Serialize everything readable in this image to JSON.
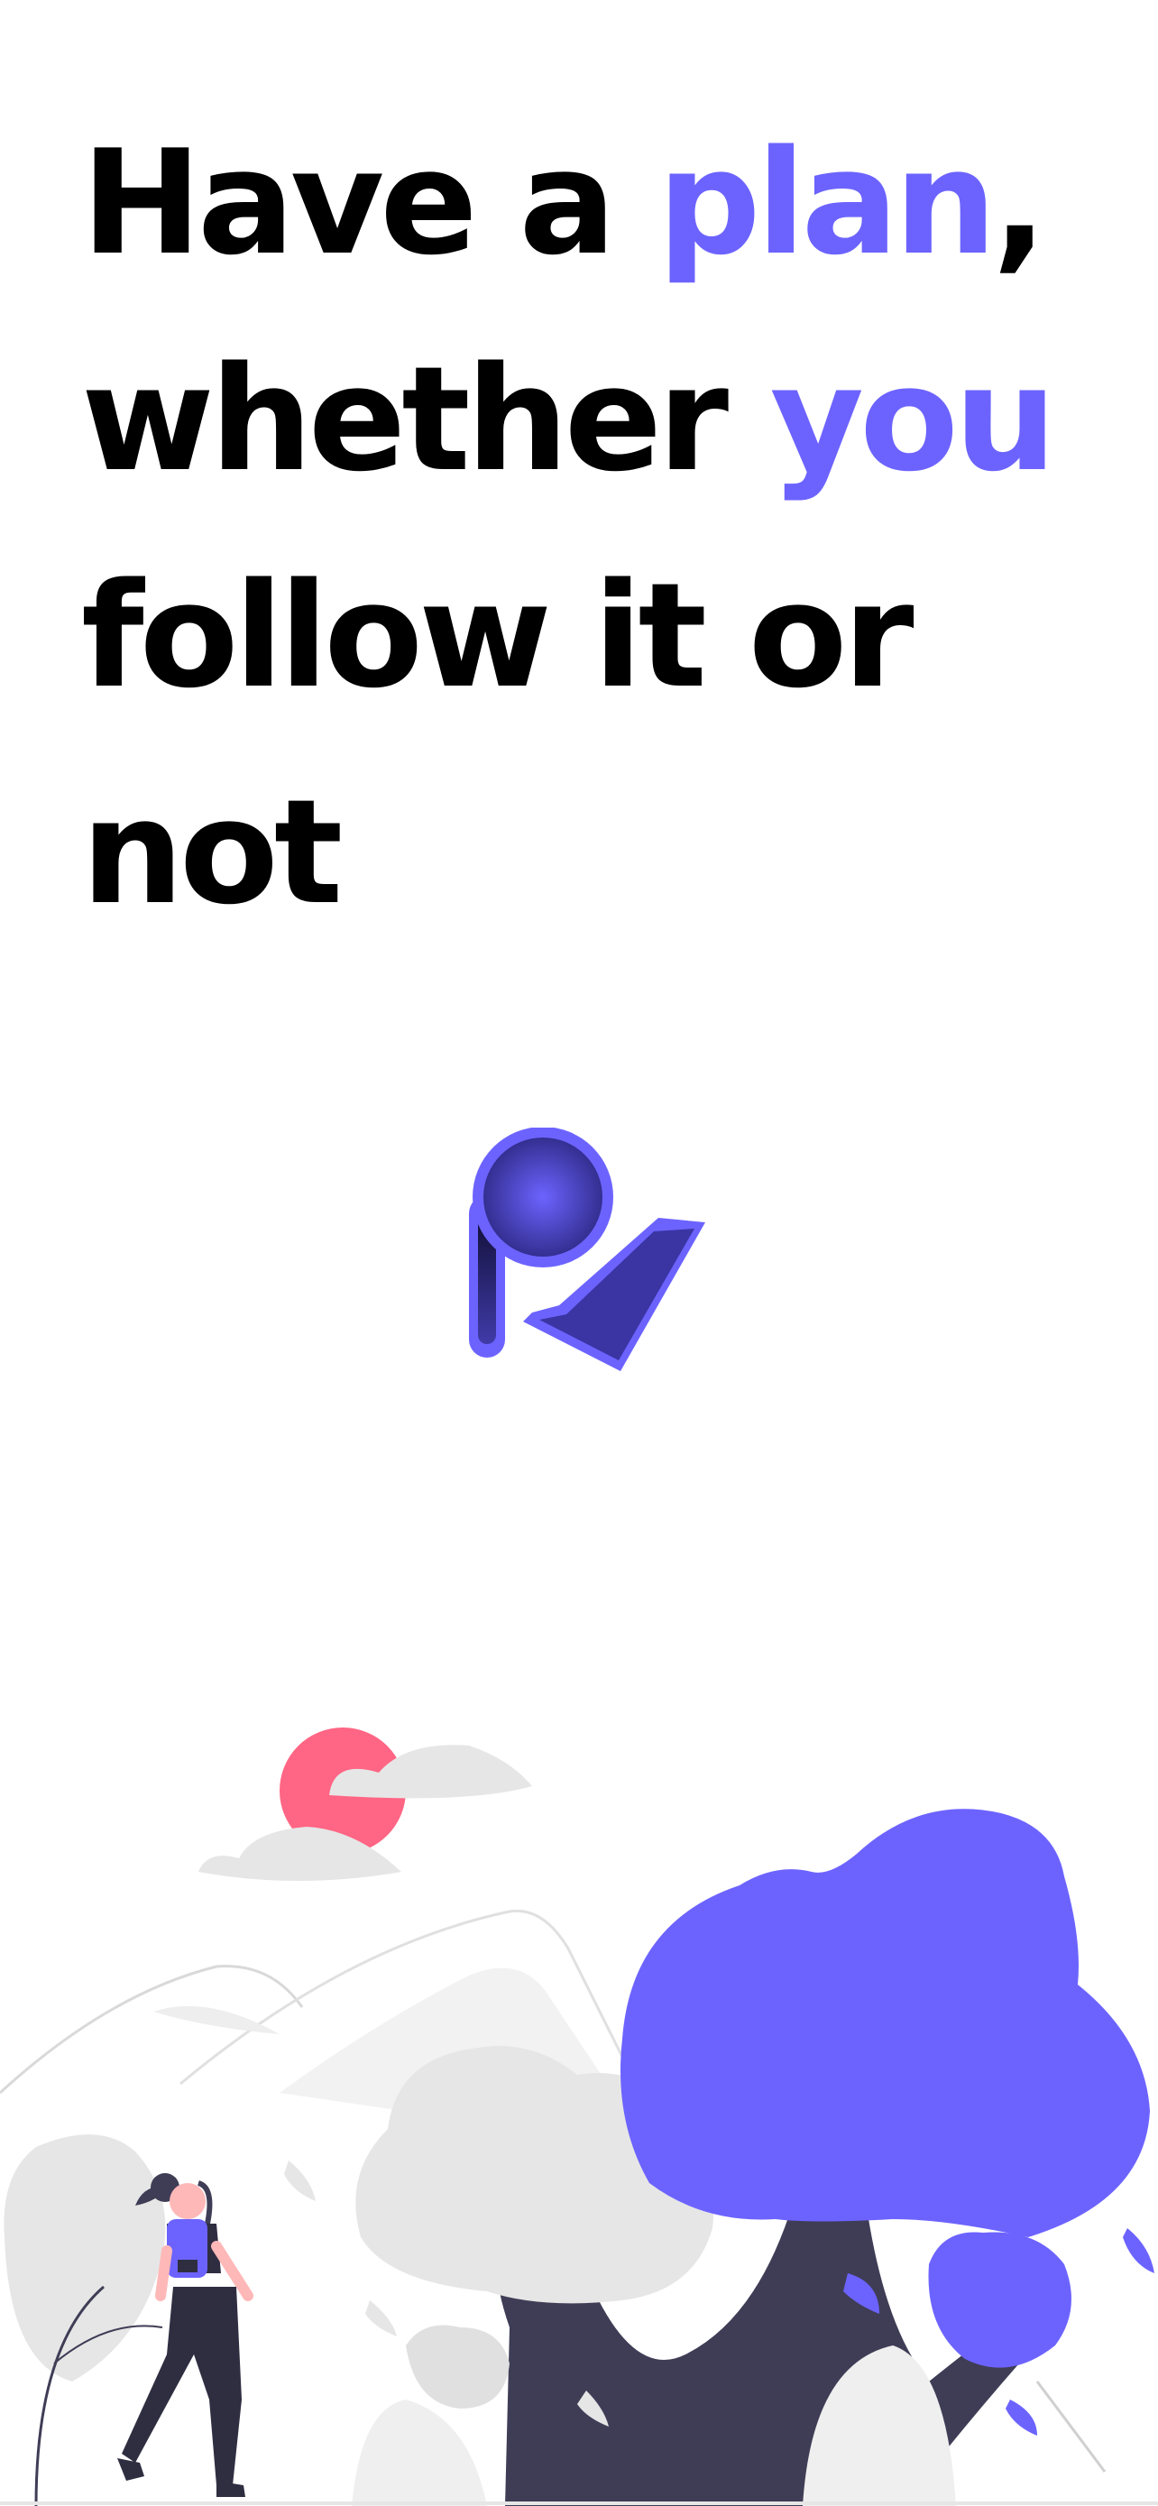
{
  "headline": {
    "line1": {
      "before": "Have a ",
      "accent": "plan",
      "after": ","
    },
    "line2": {
      "before": "whether ",
      "accent": "you"
    },
    "line3": "follow it or",
    "line4": "not"
  },
  "colors": {
    "text": "#000000",
    "accent": "#6c63ff",
    "sun": "#ff6584",
    "trunk": "#3f3d56",
    "gray": "#e6e6e6",
    "background": "#ffffff"
  },
  "icons": {
    "logo": "plan-logo-pin-check-icon",
    "illustration": "hiker-forest-illustration"
  }
}
